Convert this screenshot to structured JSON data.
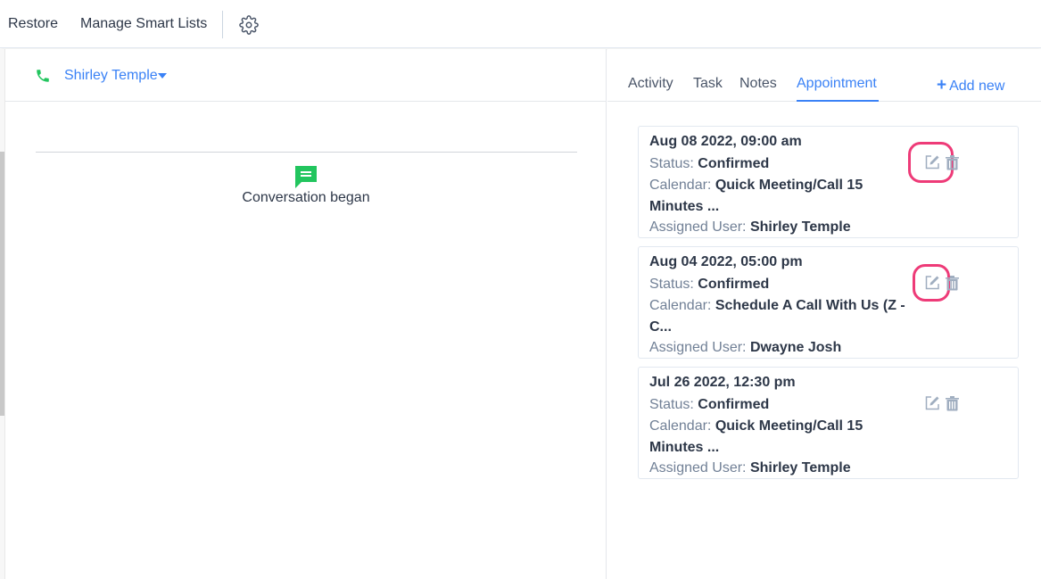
{
  "topbar": {
    "restore_label": "Restore",
    "smart_lists_label": "Manage Smart Lists",
    "settings_icon": "gear-icon"
  },
  "contact": {
    "name": "Shirley Temple",
    "phone_icon": "phone-icon",
    "phone_icon_color": "#22c55e"
  },
  "conversation": {
    "began_text": "Conversation began",
    "icon": "chat-icon",
    "icon_color": "#22c55e"
  },
  "tabs": {
    "activity": "Activity",
    "task": "Task",
    "notes": "Notes",
    "appointment": "Appointment",
    "active": "Appointment",
    "add_new": "Add new"
  },
  "labels": {
    "status": "Status:",
    "calendar": "Calendar:",
    "assigned_user": "Assigned User:"
  },
  "appointments": [
    {
      "datetime": "Aug 08 2022, 09:00 am",
      "status": "Confirmed",
      "calendar_line1": "Quick Meeting/Call 15",
      "calendar_line2": "Minutes ...",
      "assigned_user": "Shirley Temple",
      "edit_highlighted": true
    },
    {
      "datetime": "Aug 04 2022, 05:00 pm",
      "status": "Confirmed",
      "calendar_line1": "Schedule A Call With Us (Z -",
      "calendar_line2": "C...",
      "assigned_user": "Dwayne Josh",
      "edit_highlighted": true
    },
    {
      "datetime": "Jul 26 2022, 12:30 pm",
      "status": "Confirmed",
      "calendar_line1": "Quick Meeting/Call 15",
      "calendar_line2": "Minutes ...",
      "assigned_user": "Shirley Temple",
      "edit_highlighted": false
    }
  ],
  "colors": {
    "accent": "#3b82f6",
    "highlight": "#ee3b78"
  }
}
